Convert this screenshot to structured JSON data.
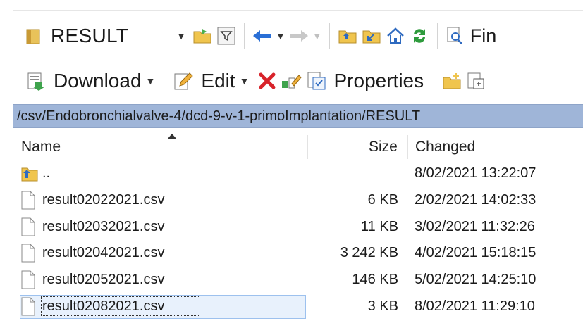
{
  "toolbar1": {
    "folder_name": "RESULT",
    "find_label": "Fin",
    "icons": [
      "folder-icon",
      "dropdown-caret",
      "open-folder-icon",
      "filter-icon",
      "back-arrow-icon",
      "forward-arrow-icon",
      "parent-dir-icon",
      "root-dir-icon",
      "home-icon",
      "refresh-icon",
      "find-icon"
    ]
  },
  "toolbar2": {
    "download_label": "Download",
    "edit_label": "Edit",
    "properties_label": "Properties"
  },
  "path": "/csv/Endobronchialvalve-4/dcd-9-v-1-primoImplantation/RESULT",
  "columns": {
    "name": "Name",
    "size": "Size",
    "changed": "Changed"
  },
  "files": [
    {
      "name": "..",
      "size": "",
      "changed": "8/02/2021 13:22:07",
      "type": "parent"
    },
    {
      "name": "result02022021.csv",
      "size": "6 KB",
      "changed": "2/02/2021 14:02:33",
      "type": "file"
    },
    {
      "name": "result02032021.csv",
      "size": "11 KB",
      "changed": "3/02/2021 11:32:26",
      "type": "file"
    },
    {
      "name": "result02042021.csv",
      "size": "3 242 KB",
      "changed": "4/02/2021 15:18:15",
      "type": "file"
    },
    {
      "name": "result02052021.csv",
      "size": "146 KB",
      "changed": "5/02/2021 14:25:10",
      "type": "file"
    },
    {
      "name": "result02082021.csv",
      "size": "3 KB",
      "changed": "8/02/2021 11:29:10",
      "type": "file",
      "selected": true
    }
  ],
  "colors": {
    "path_bar": "#9fb5d8",
    "selection": "#e8f1fc",
    "delete_red": "#d8232a",
    "nav_blue": "#2a6fd6"
  }
}
